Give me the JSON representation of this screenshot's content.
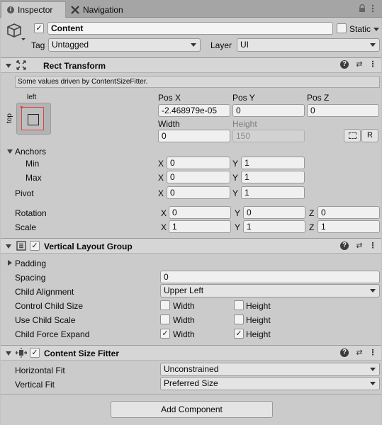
{
  "tabs": [
    {
      "label": "Inspector"
    },
    {
      "label": "Navigation"
    }
  ],
  "header": {
    "object_name": "Content",
    "static_label": "Static",
    "tag_label": "Tag",
    "tag_value": "Untagged",
    "layer_label": "Layer",
    "layer_value": "UI"
  },
  "rect_transform": {
    "title": "Rect Transform",
    "driven_note": "Some values driven by ContentSizeFitter.",
    "anchor_preset_top": "left",
    "anchor_preset_side": "top",
    "pos_x_label": "Pos X",
    "pos_y_label": "Pos Y",
    "pos_z_label": "Pos Z",
    "pos_x": "-2.468979e-05",
    "pos_y": "0",
    "pos_z": "0",
    "width_label": "Width",
    "height_label": "Height",
    "width": "0",
    "height": "150",
    "raw_button": "R",
    "anchors_label": "Anchors",
    "min_label": "Min",
    "max_label": "Max",
    "min_x": "0",
    "min_y": "1",
    "max_x": "0",
    "max_y": "1",
    "pivot_label": "Pivot",
    "pivot_x": "0",
    "pivot_y": "1",
    "rotation_label": "Rotation",
    "rot_x": "0",
    "rot_y": "0",
    "rot_z": "0",
    "scale_label": "Scale",
    "scale_x": "1",
    "scale_y": "1",
    "scale_z": "1",
    "x": "X",
    "y": "Y",
    "z": "Z"
  },
  "vertical_layout": {
    "title": "Vertical Layout Group",
    "padding_label": "Padding",
    "spacing_label": "Spacing",
    "spacing_value": "0",
    "child_alignment_label": "Child Alignment",
    "child_alignment_value": "Upper Left",
    "control_child_size_label": "Control Child Size",
    "use_child_scale_label": "Use Child Scale",
    "child_force_expand_label": "Child Force Expand",
    "width_label": "Width",
    "height_label": "Height",
    "control_child_size": {
      "width": false,
      "height": false
    },
    "use_child_scale": {
      "width": false,
      "height": false
    },
    "child_force_expand": {
      "width": true,
      "height": true
    }
  },
  "content_size_fitter": {
    "title": "Content Size Fitter",
    "horizontal_fit_label": "Horizontal Fit",
    "horizontal_fit_value": "Unconstrained",
    "vertical_fit_label": "Vertical Fit",
    "vertical_fit_value": "Preferred Size"
  },
  "add_component_label": "Add Component",
  "checkmark": "✓"
}
